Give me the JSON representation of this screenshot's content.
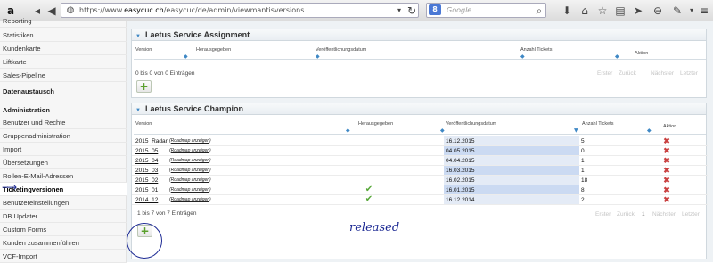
{
  "browser": {
    "url_prefix": "https://www.",
    "url_host": "easycuc.ch",
    "url_path": "/easycuc/de/admin/viewmantisversions",
    "search_placeholder": "Google",
    "search_engine_badge": "8"
  },
  "sidebar": {
    "items": [
      {
        "label": "Reporting"
      },
      {
        "label": "Statistiken"
      },
      {
        "label": "Kundenkarte"
      },
      {
        "label": "Liftkarte"
      },
      {
        "label": "Sales-Pipeline"
      },
      {
        "label": "Datenaustausch"
      },
      {
        "label": "Administration"
      },
      {
        "label": "Benutzer und Rechte"
      },
      {
        "label": "Gruppenadministration"
      },
      {
        "label": "Import"
      },
      {
        "label": "Übersetzungen"
      },
      {
        "label": "Rollen-E-Mail-Adressen"
      },
      {
        "label": "Ticketingversionen"
      },
      {
        "label": "Benutzereinstellungen"
      },
      {
        "label": "DB Updater"
      },
      {
        "label": "Custom Forms"
      },
      {
        "label": "Kunden zusammenführen"
      },
      {
        "label": "VCF-Import"
      }
    ]
  },
  "assignment": {
    "title": "Laetus Service Assignment",
    "columns": {
      "version": "Version",
      "released": "Herausgegeben",
      "date": "Veröffentlichungsdatum",
      "count": "Anzahl Tickets",
      "action": "Aktion"
    },
    "info": "0 bis 0 von 0 Einträgen",
    "pager": {
      "first": "Erster",
      "prev": "Zurück",
      "next": "Nächster",
      "last": "Letzter"
    },
    "add_label": "+"
  },
  "champion": {
    "title": "Laetus Service Champion",
    "columns": {
      "version": "Version",
      "released": "Herausgegeben",
      "date": "Veröffentlichungsdatum",
      "count": "Anzahl Tickets",
      "action": "Aktion"
    },
    "rows": [
      {
        "version": "2015_Radar",
        "roadmap": "Roadmap anzeigen",
        "released": "",
        "date": "16.12.2015",
        "count": "5",
        "delete": "✖"
      },
      {
        "version": "2015_05",
        "roadmap": "Roadmap anzeigen",
        "released": "",
        "date": "04.05.2015",
        "count": "0",
        "delete": "✖"
      },
      {
        "version": "2015_04",
        "roadmap": "Roadmap anzeigen",
        "released": "",
        "date": "04.04.2015",
        "count": "1",
        "delete": "✖"
      },
      {
        "version": "2015_03",
        "roadmap": "Roadmap anzeigen",
        "released": "",
        "date": "16.03.2015",
        "count": "1",
        "delete": "✖"
      },
      {
        "version": "2015_02",
        "roadmap": "Roadmap anzeigen",
        "released": "",
        "date": "16.02.2015",
        "count": "18",
        "delete": "✖"
      },
      {
        "version": "2015_01",
        "roadmap": "Roadmap anzeigen",
        "released": "✔",
        "date": "16.01.2015",
        "count": "8",
        "delete": "✖"
      },
      {
        "version": "2014_12",
        "roadmap": "Roadmap anzeigen",
        "released": "✔",
        "date": "16.12.2014",
        "count": "2",
        "delete": "✖"
      }
    ],
    "info": "1 bis 7 von 7 Einträgen",
    "pager": {
      "first": "Erster",
      "prev": "Zurück",
      "page": "1",
      "next": "Nächster",
      "last": "Letzter"
    },
    "add_label": "+"
  },
  "annotation": {
    "text": "released"
  }
}
